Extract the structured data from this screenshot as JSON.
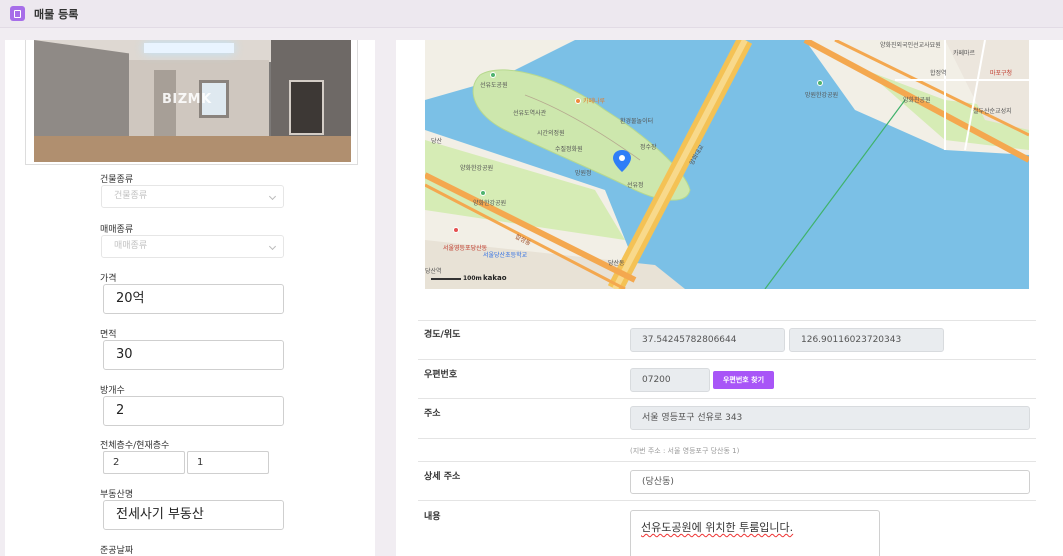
{
  "header": {
    "title": "매물 등록"
  },
  "photo": {
    "watermark": "BIZMK"
  },
  "form": {
    "building_type": {
      "label": "건물종류",
      "placeholder": "건물종류"
    },
    "sale_type": {
      "label": "매매종류",
      "placeholder": "매매종류"
    },
    "price": {
      "label": "가격",
      "value": "20억"
    },
    "area": {
      "label": "면적",
      "value": "30"
    },
    "rooms": {
      "label": "방개수",
      "value": "2"
    },
    "floors": {
      "label": "전체층수/현재층수",
      "total": "2",
      "current": "1"
    },
    "agency": {
      "label": "부동산명",
      "value": "전세사기 부동산"
    },
    "completion_date": {
      "label": "준공날짜"
    }
  },
  "map": {
    "labels": {
      "a": "선유도공원",
      "b": "카페나루",
      "c": "선유도역사관",
      "d": "시간의정원",
      "e": "환경물놀이터",
      "f": "양화한강공원",
      "g": "양화대교",
      "h": "당산역",
      "i": "서울당산초등학교",
      "j": "서울영등포당산동",
      "k": "합정역",
      "l": "망원한강공원",
      "m": "절두산순교성지",
      "n": "양화진외국인선교사묘원",
      "o": "카페마르",
      "p": "수질정화원",
      "q": "정수장",
      "r": "망원정",
      "s": "선유정",
      "t": "당산",
      "u": "100m",
      "v": "kakao",
      "w": "양화한강공원",
      "x": "합정동",
      "y": "마포구청",
      "z": "양화진공원",
      "aa": "당산동"
    }
  },
  "detail": {
    "coords": {
      "label": "경도/위도",
      "lat": "37.54245782806644",
      "lng": "126.90116023720343"
    },
    "postcode": {
      "label": "우편번호",
      "value": "07200",
      "button": "우편번호 찾기"
    },
    "address": {
      "label": "주소",
      "value": "서울 영등포구 선유로 343",
      "jibun": "(지번 주소 : 서울 영등포구 당산동 1)"
    },
    "detail_address": {
      "label": "상세 주소",
      "value": "(당산동)"
    },
    "content": {
      "label": "내용",
      "value": "선유도공원에 위치한 투룸입니다."
    }
  },
  "colors": {
    "accent": "#a855f7",
    "water": "#7bc0e6",
    "land": "#f2efe6",
    "road": "#f4c255",
    "park": "#d6ecb5"
  },
  "icons": {
    "logo": "building-icon",
    "pin": "map-pin-icon"
  }
}
